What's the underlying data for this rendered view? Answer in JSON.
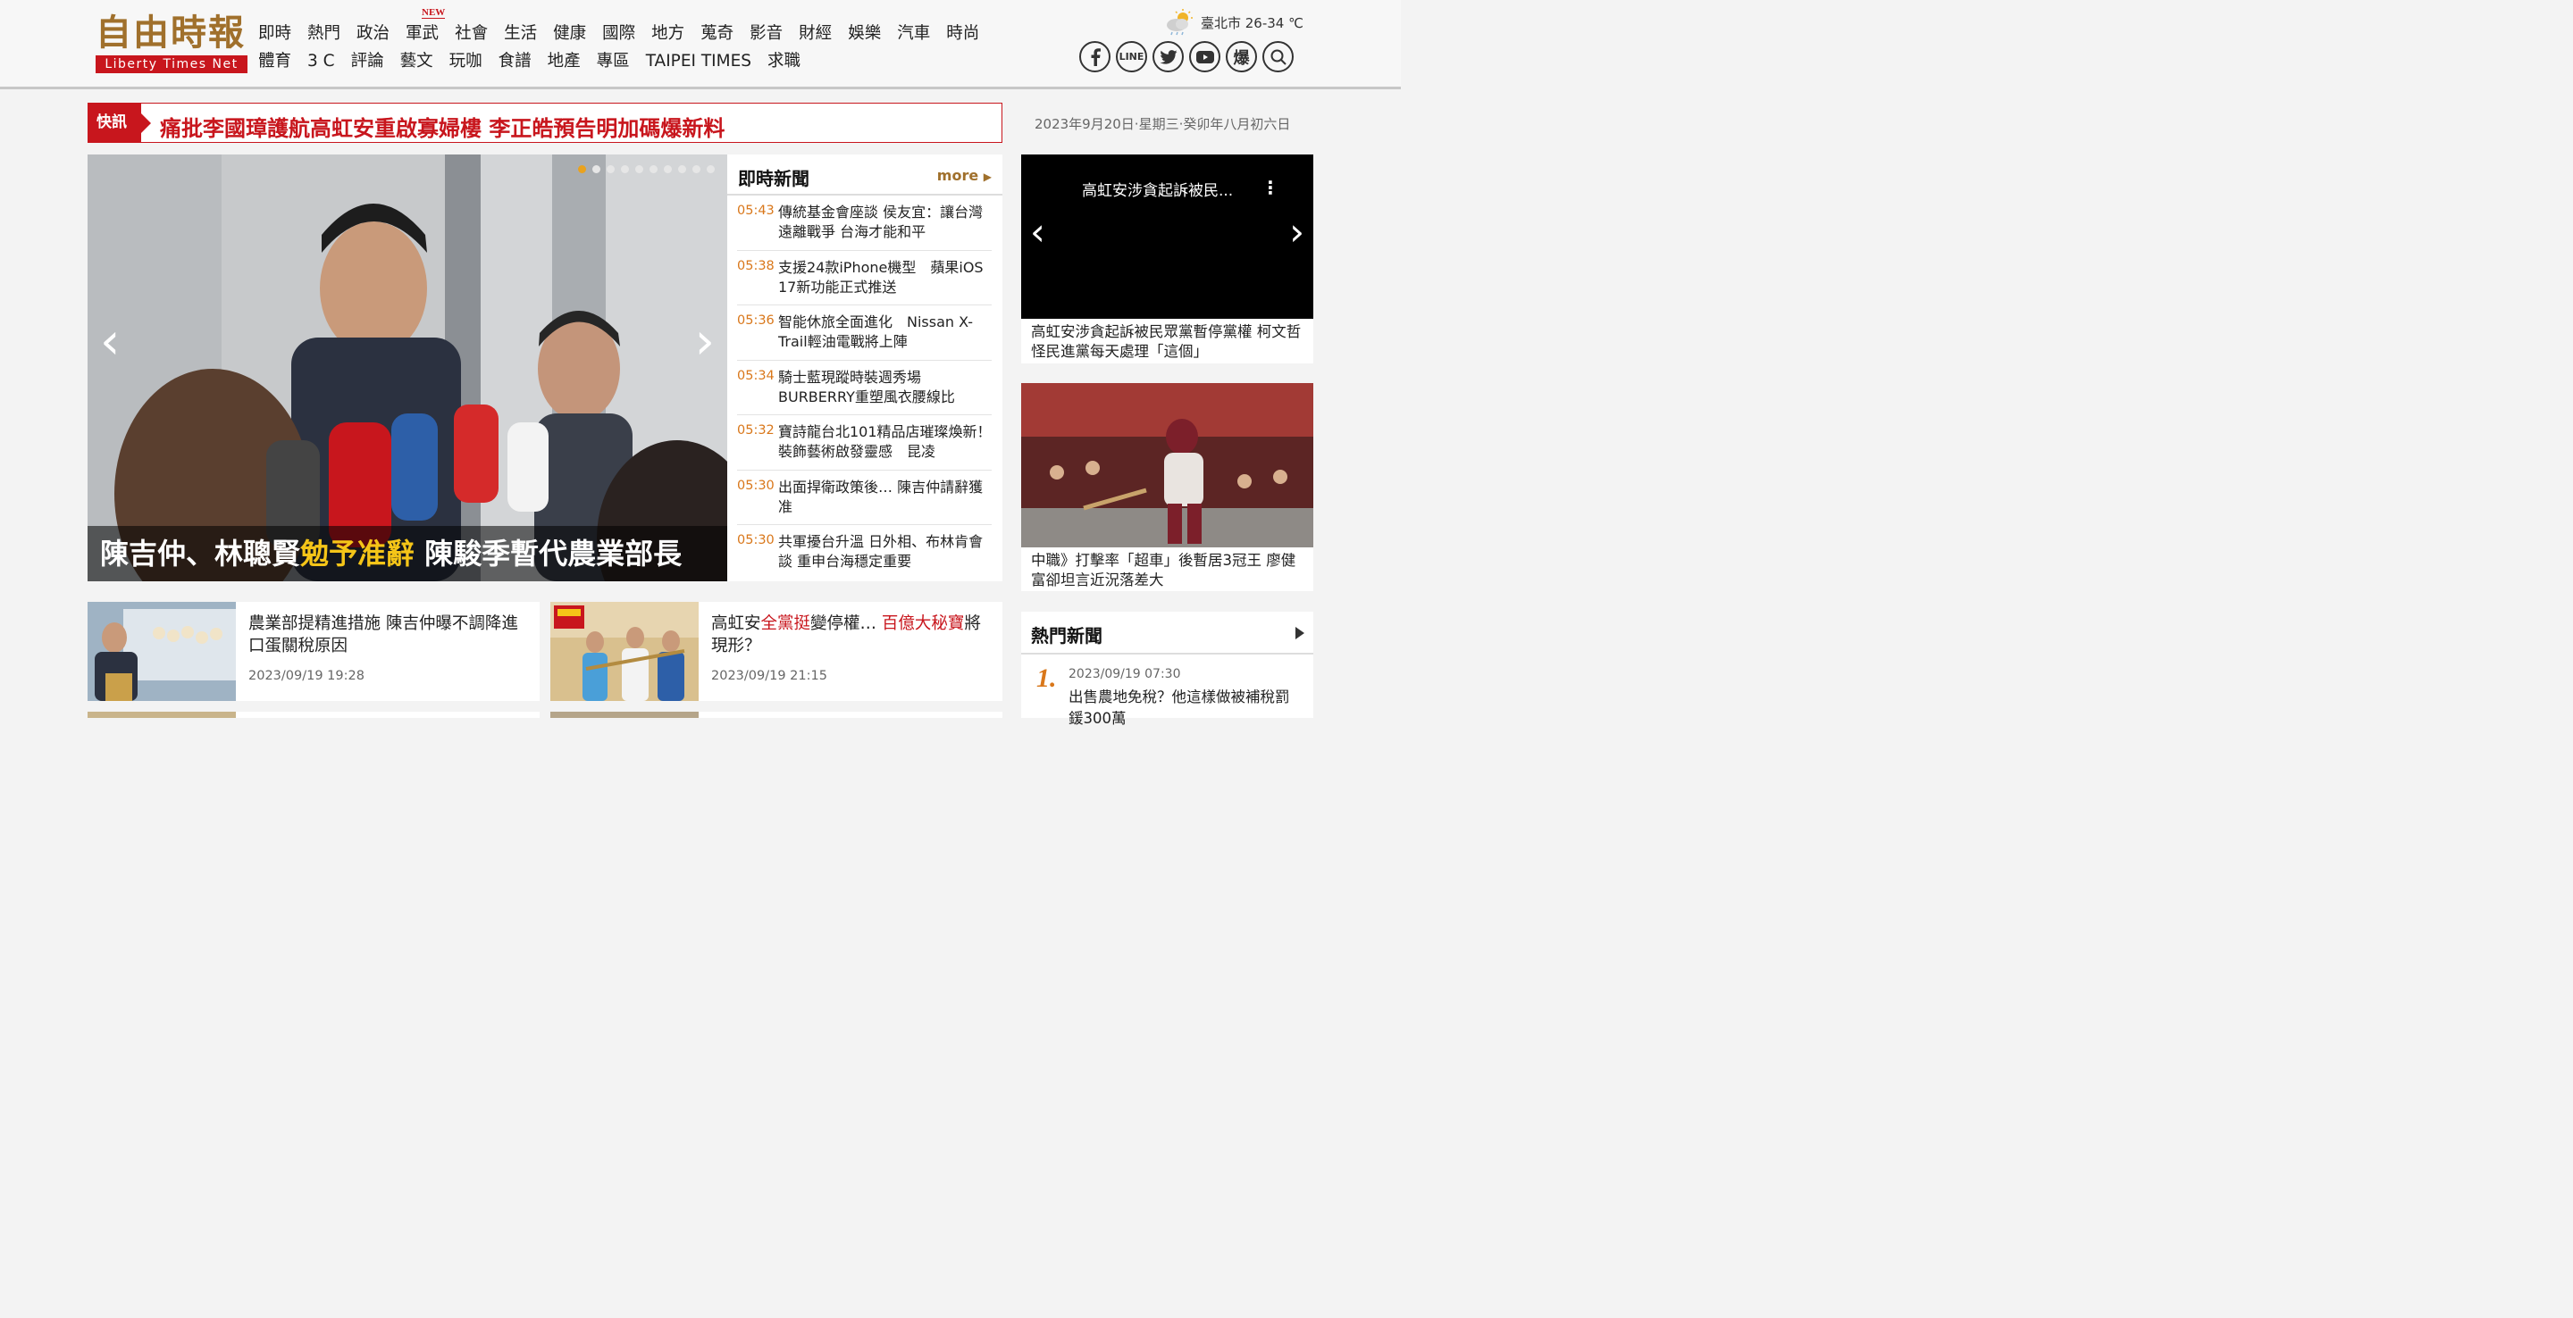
{
  "brand": {
    "name_cn": "自由時報",
    "name_en": "Liberty Times Net"
  },
  "nav": {
    "row1": [
      "即時",
      "熱門",
      "政治",
      "軍武",
      "社會",
      "生活",
      "健康",
      "國際",
      "地方",
      "蒐奇",
      "影音",
      "財經",
      "娛樂",
      "汽車",
      "時尚"
    ],
    "row2": [
      "體育",
      "3 C",
      "評論",
      "藝文",
      "玩咖",
      "食譜",
      "地產",
      "專區",
      "TAIPEI TIMES",
      "求職"
    ],
    "new_badge": "NEW"
  },
  "weather": {
    "text": "臺北市 26-34 ℃",
    "icon": "partly-cloudy-rain-icon"
  },
  "social": {
    "line_label": "LINE",
    "bao_label": "爆"
  },
  "breaking": {
    "tag": "快訊",
    "headline": "痛批李國璋護航高虹安重啟寡婦樓 李正皓預告明加碼爆新料"
  },
  "date_line": "2023年9月20日‧星期三‧癸卯年八月初六日",
  "hero": {
    "caption_pre": "陳吉仲、林聰賢",
    "caption_highlight": "勉予准辭",
    "caption_post": " 陳駿季暫代農業部長",
    "slides": 10,
    "active_slide": 1,
    "prev": "‹",
    "next": "›"
  },
  "instant_news": {
    "title": "即時新聞",
    "more_label": "more",
    "items": [
      {
        "time": "05:43",
        "title": "傳統基金會座談 侯友宜：讓台灣遠離戰爭 台海才能和平"
      },
      {
        "time": "05:38",
        "title": "支援24款iPhone機型　蘋果iOS 17新功能正式推送"
      },
      {
        "time": "05:36",
        "title": "智能休旅全面進化　Nissan X-Trail輕油電戰將上陣"
      },
      {
        "time": "05:34",
        "title": "騎士藍現蹤時裝週秀場　BURBERRY重塑風衣腰線比"
      },
      {
        "time": "05:32",
        "title": "寶詩龍台北101精品店璀璨煥新！裝飾藝術啟發靈感　昆凌"
      },
      {
        "time": "05:30",
        "title": "出面捍衛政策後… 陳吉仲請辭獲准"
      },
      {
        "time": "05:30",
        "title": "共軍擾台升溫 日外相、布林肯會談 重申台海穩定重要"
      }
    ]
  },
  "video": {
    "title": "高虹安涉貪起訴被民...",
    "caption": "高虹安涉貪起訴被民眾黨暫停黨權 柯文哲怪民進黨每天處理「這個」",
    "prev": "‹",
    "next": "›"
  },
  "sports": {
    "caption": "中職》打擊率「超車」後暫居3冠王 廖健富卻坦言近況落差大"
  },
  "stories": [
    {
      "title": "農業部提精進措施 陳吉仲曝不調降進口蛋關稅原因",
      "date": "2023/09/19 19:28"
    },
    {
      "title_a": "高虹安",
      "title_b": "全黨挺",
      "title_c": "變停權… ",
      "title_d": "百億大秘寶",
      "title_e": "將現形？",
      "date": "2023/09/19 21:15"
    }
  ],
  "hot_news": {
    "title": "熱門新聞",
    "rank": "1.",
    "date": "2023/09/19 07:30",
    "text": "出售農地免稅？他這樣做被補稅罰鍰300萬"
  },
  "colors": {
    "brand_red": "#c8161d",
    "brand_gold": "#a0702c",
    "time_orange": "#d9771a"
  }
}
